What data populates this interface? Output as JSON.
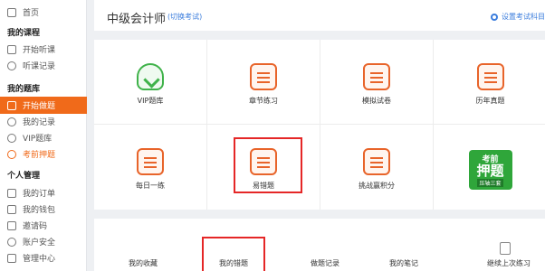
{
  "sidebar": {
    "home": "首页",
    "sections": {
      "course": "我的课程",
      "bank": "我的题库",
      "personal": "个人管理"
    },
    "items": [
      {
        "label": "开始听课",
        "icon": "play-icon"
      },
      {
        "label": "听课记录",
        "icon": "history-icon"
      },
      {
        "label": "开始做题",
        "icon": "edit-icon"
      },
      {
        "label": "我的记录",
        "icon": "history-icon"
      },
      {
        "label": "VIP题库",
        "icon": "vip-icon"
      },
      {
        "label": "考前押题",
        "icon": "target-icon"
      },
      {
        "label": "我的订单",
        "icon": "order-icon"
      },
      {
        "label": "我的钱包",
        "icon": "wallet-icon"
      },
      {
        "label": "邀请码",
        "icon": "invite-icon"
      },
      {
        "label": "账户安全",
        "icon": "security-icon"
      },
      {
        "label": "管理中心",
        "icon": "manage-icon"
      }
    ]
  },
  "header": {
    "title": "中级会计师",
    "switch": "(切换考试)",
    "settings": "设置考试科目"
  },
  "grid": [
    {
      "label": "VIP题库",
      "icon": "vip-heart-icon"
    },
    {
      "label": "章节练习",
      "icon": "chapter-icon"
    },
    {
      "label": "模拟试卷",
      "icon": "mock-exam-icon"
    },
    {
      "label": "历年真题",
      "icon": "past-papers-icon"
    },
    {
      "label": "每日一练",
      "icon": "calendar-icon"
    },
    {
      "label": "易错题",
      "icon": "error-question-icon"
    },
    {
      "label": "挑战赢积分",
      "icon": "challenge-icon"
    },
    {
      "label": "",
      "icon": "promo-banner"
    }
  ],
  "promo": {
    "t1": "考前",
    "t2": "押题",
    "t3": "压轴三套"
  },
  "bottom": [
    "我的收藏",
    "我的错题",
    "做题记录",
    "我的笔记",
    "继续上次练习"
  ],
  "colors": {
    "accent": "#f06a1a",
    "vip": "#3fb24a",
    "link": "#3b7ddd",
    "highlight": "#e52727"
  }
}
